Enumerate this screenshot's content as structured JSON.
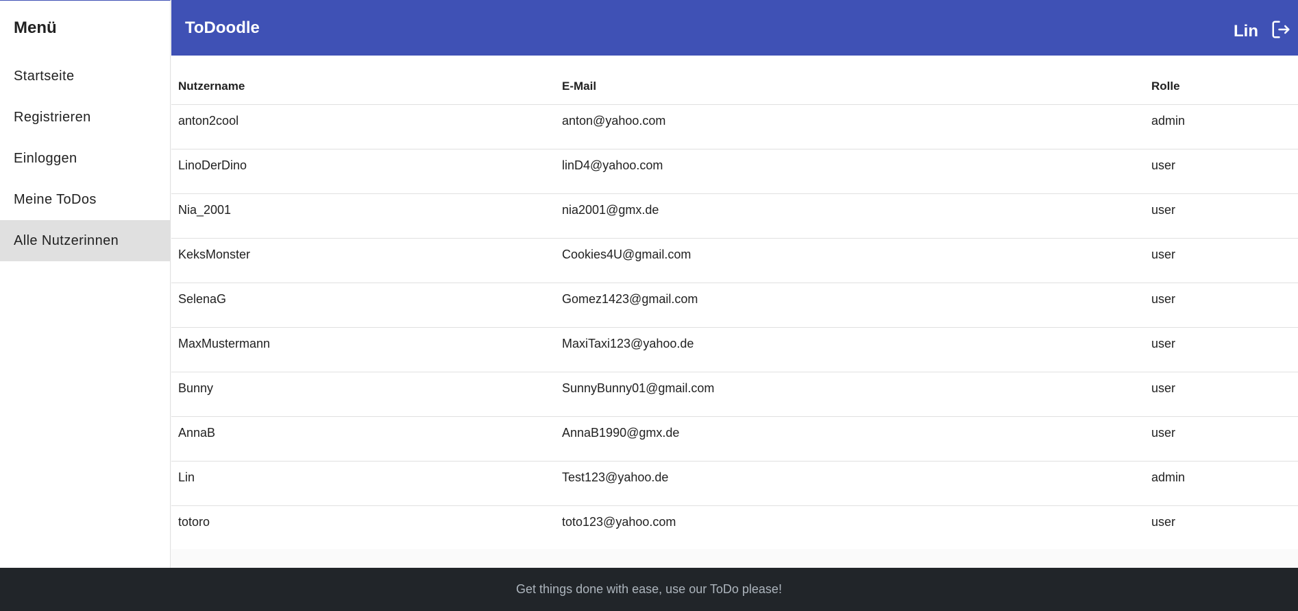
{
  "sidebar": {
    "title": "Menü",
    "items": [
      {
        "label": "Startseite",
        "active": false
      },
      {
        "label": "Registrieren",
        "active": false
      },
      {
        "label": "Einloggen",
        "active": false
      },
      {
        "label": "Meine ToDos",
        "active": false
      },
      {
        "label": "Alle Nutzerinnen",
        "active": true
      }
    ]
  },
  "toolbar": {
    "title": "ToDoodle",
    "user": "Lin",
    "logout_icon": "logout-icon"
  },
  "table": {
    "headers": [
      "Nutzername",
      "E-Mail",
      "Rolle"
    ],
    "rows": [
      [
        "anton2cool",
        "anton@yahoo.com",
        "admin"
      ],
      [
        "LinoDerDino",
        "linD4@yahoo.com",
        "user"
      ],
      [
        "Nia_2001",
        "nia2001@gmx.de",
        "user"
      ],
      [
        "KeksMonster",
        "Cookies4U@gmail.com",
        "user"
      ],
      [
        "SelenaG",
        "Gomez1423@gmail.com",
        "user"
      ],
      [
        "MaxMustermann",
        "MaxiTaxi123@yahoo.de",
        "user"
      ],
      [
        "Bunny",
        "SunnyBunny01@gmail.com",
        "user"
      ],
      [
        "AnnaB",
        "AnnaB1990@gmx.de",
        "user"
      ],
      [
        "Lin",
        "Test123@yahoo.de",
        "admin"
      ],
      [
        "totoro",
        "toto123@yahoo.com",
        "user"
      ]
    ]
  },
  "footer": {
    "text": "Get things done with ease, use our ToDo please!"
  },
  "colors": {
    "primary": "#3f51b5",
    "footer_bg": "#212529",
    "active_nav": "#e0e0e0"
  }
}
